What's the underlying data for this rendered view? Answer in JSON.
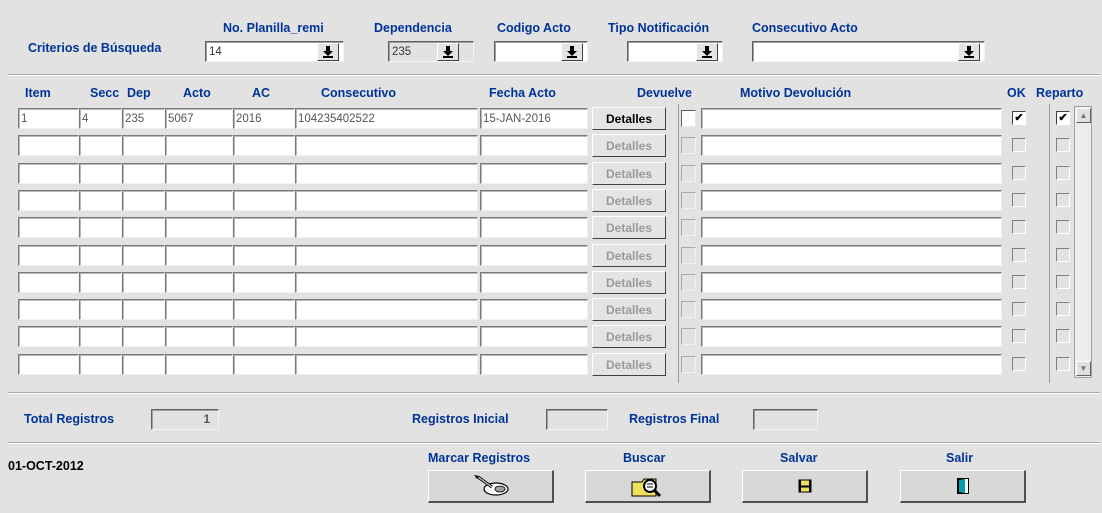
{
  "search": {
    "title": "Criterios de Búsqueda",
    "planilla": {
      "label": "No. Planilla_remi",
      "value": "14"
    },
    "dependencia": {
      "label": "Dependencia",
      "value": "235"
    },
    "codigo_acto": {
      "label": "Codigo Acto",
      "value": ""
    },
    "tipo_notificacion": {
      "label": "Tipo Notificación",
      "value": ""
    },
    "consecutivo_acto": {
      "label": "Consecutivo Acto",
      "value": ""
    }
  },
  "grid": {
    "headers": {
      "item": "Item",
      "secc": "Secc",
      "dep": "Dep",
      "acto": "Acto",
      "ac": "AC",
      "consecutivo": "Consecutivo",
      "fecha_acto": "Fecha Acto",
      "devuelve": "Devuelve",
      "motivo": "Motivo Devolución",
      "ok": "OK",
      "reparto": "Reparto"
    },
    "detalles_label": "Detalles",
    "check_mark": "✔",
    "rows": [
      {
        "item": "1",
        "secc": "4",
        "dep": "235",
        "acto": "5067",
        "ac": "2016",
        "consecutivo": "104235402522",
        "fecha": "15-JAN-2016",
        "motivo": "",
        "devuelve": false,
        "ok": true,
        "reparto": true
      },
      {
        "item": "",
        "secc": "",
        "dep": "",
        "acto": "",
        "ac": "",
        "consecutivo": "",
        "fecha": "",
        "motivo": "",
        "devuelve": false,
        "ok": false,
        "reparto": false
      },
      {
        "item": "",
        "secc": "",
        "dep": "",
        "acto": "",
        "ac": "",
        "consecutivo": "",
        "fecha": "",
        "motivo": "",
        "devuelve": false,
        "ok": false,
        "reparto": false
      },
      {
        "item": "",
        "secc": "",
        "dep": "",
        "acto": "",
        "ac": "",
        "consecutivo": "",
        "fecha": "",
        "motivo": "",
        "devuelve": false,
        "ok": false,
        "reparto": false
      },
      {
        "item": "",
        "secc": "",
        "dep": "",
        "acto": "",
        "ac": "",
        "consecutivo": "",
        "fecha": "",
        "motivo": "",
        "devuelve": false,
        "ok": false,
        "reparto": false
      },
      {
        "item": "",
        "secc": "",
        "dep": "",
        "acto": "",
        "ac": "",
        "consecutivo": "",
        "fecha": "",
        "motivo": "",
        "devuelve": false,
        "ok": false,
        "reparto": false
      },
      {
        "item": "",
        "secc": "",
        "dep": "",
        "acto": "",
        "ac": "",
        "consecutivo": "",
        "fecha": "",
        "motivo": "",
        "devuelve": false,
        "ok": false,
        "reparto": false
      },
      {
        "item": "",
        "secc": "",
        "dep": "",
        "acto": "",
        "ac": "",
        "consecutivo": "",
        "fecha": "",
        "motivo": "",
        "devuelve": false,
        "ok": false,
        "reparto": false
      },
      {
        "item": "",
        "secc": "",
        "dep": "",
        "acto": "",
        "ac": "",
        "consecutivo": "",
        "fecha": "",
        "motivo": "",
        "devuelve": false,
        "ok": false,
        "reparto": false
      },
      {
        "item": "",
        "secc": "",
        "dep": "",
        "acto": "",
        "ac": "",
        "consecutivo": "",
        "fecha": "",
        "motivo": "",
        "devuelve": false,
        "ok": false,
        "reparto": false
      }
    ]
  },
  "totals": {
    "total_label": "Total Registros",
    "total_value": "1",
    "inicial_label": "Registros Inicial",
    "inicial_value": "",
    "final_label": "Registros Final",
    "final_value": ""
  },
  "footer": {
    "date": "01-OCT-2012",
    "marcar_label": "Marcar Registros",
    "buscar_label": "Buscar",
    "salvar_label": "Salvar",
    "salir_label": "Salir"
  },
  "icons": {
    "dropdown": "down-arrow-icon",
    "marcar": "marker-pen-icon",
    "buscar": "magnifier-folder-icon",
    "salvar": "floppy-disk-icon",
    "salir": "exit-door-icon"
  }
}
